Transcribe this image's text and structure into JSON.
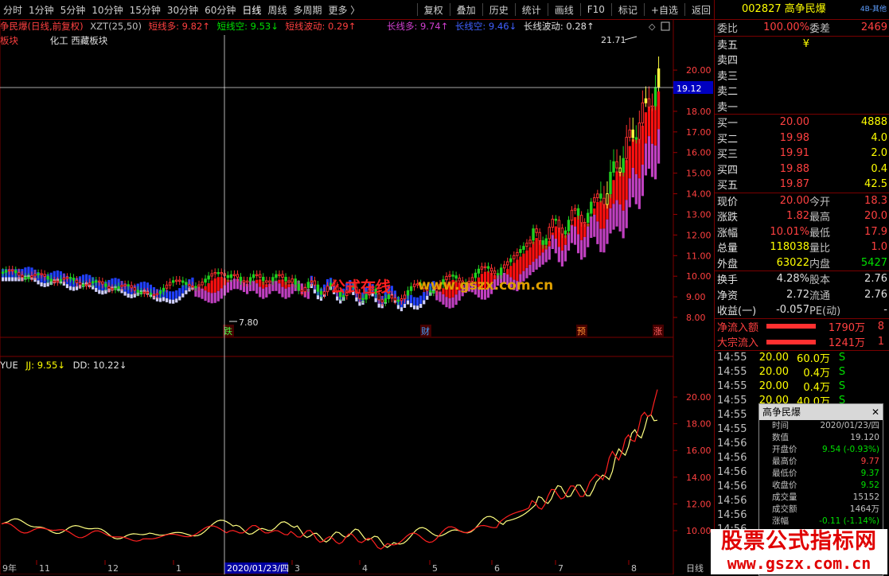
{
  "toolbar": {
    "periods": [
      "分时",
      "1分钟",
      "5分钟",
      "10分钟",
      "15分钟",
      "30分钟",
      "60分钟",
      "日线",
      "周线",
      "多周期",
      "更多 〉"
    ],
    "actions": [
      "复权",
      "叠加",
      "历史",
      "统计",
      "画线",
      "F10",
      "标记",
      "+自选",
      "返回"
    ]
  },
  "indicator_line": {
    "stock": "争民爆(日线,前复权)",
    "formula": "XZT(25,50)",
    "short_long": "短线多: 9.82↑",
    "short_short": "短线空: 9.53↓",
    "short_vol": "短线波动: 0.29↑",
    "long_long": "长线多: 9.74↑",
    "long_short": "长线空: 9.46↓",
    "long_vol": "长线波动: 0.28↑"
  },
  "sector_line": {
    "a": "板块",
    "b": "化工 西藏板块"
  },
  "main_chart": {
    "y_ticks": [
      "20.00",
      "19.00",
      "18.00",
      "17.00",
      "16.00",
      "15.00",
      "14.00",
      "13.00",
      "12.00",
      "11.00",
      "10.00",
      "9.00",
      "8.00"
    ],
    "high_label": "21.71",
    "low_label": "7.80",
    "cursor_price": "19.12",
    "events": [
      "跌",
      "财",
      "预",
      "涨"
    ]
  },
  "sub_chart": {
    "name": "YUE",
    "jj": "JJ: 9.55↓",
    "dd": "DD: 10.22↓",
    "y_ticks": [
      "20.00",
      "18.00",
      "16.00",
      "14.00",
      "12.00",
      "10.00"
    ]
  },
  "x_axis": {
    "labels": [
      "9年",
      "11",
      "12",
      "1",
      "2020/01/23/四",
      "3",
      "4",
      "5",
      "6",
      "7",
      "8"
    ],
    "period": "日线"
  },
  "watermark_center": {
    "a": "公式在线",
    "b": "www.gszx.com.cn"
  },
  "quote": {
    "code_name": "002827 高争民爆",
    "tag": "4B-其他",
    "weibi_label": "委比",
    "weibi": "100.00%",
    "weicha_label": "委差",
    "weicha": "2469",
    "sells": [
      {
        "l": "卖五",
        "p": "¥"
      },
      {
        "l": "卖四",
        "p": ""
      },
      {
        "l": "卖三",
        "p": ""
      },
      {
        "l": "卖二",
        "p": ""
      },
      {
        "l": "卖一",
        "p": ""
      }
    ],
    "buys": [
      {
        "l": "买一",
        "p": "20.00",
        "v": "4888"
      },
      {
        "l": "买二",
        "p": "19.98",
        "v": "4.0"
      },
      {
        "l": "买三",
        "p": "19.91",
        "v": "2.0"
      },
      {
        "l": "买四",
        "p": "19.88",
        "v": "0.4"
      },
      {
        "l": "买五",
        "p": "19.87",
        "v": "42.5"
      }
    ],
    "stats": [
      {
        "l": "现价",
        "v": "20.00",
        "l2": "今开",
        "v2": "18.3"
      },
      {
        "l": "涨跌",
        "v": "1.82",
        "l2": "最高",
        "v2": "20.0"
      },
      {
        "l": "涨幅",
        "v": "10.01%",
        "l2": "最低",
        "v2": "17.9"
      },
      {
        "l": "总量",
        "v": "118038",
        "l2": "量比",
        "v2": "1.0"
      },
      {
        "l": "外盘",
        "v": "63022",
        "l2": "内盘",
        "v2": "5427"
      }
    ],
    "stats2": [
      {
        "l": "换手",
        "v": "4.28%",
        "l2": "股本",
        "v2": "2.76"
      },
      {
        "l": "净资",
        "v": "2.72",
        "l2": "流通",
        "v2": "2.76"
      },
      {
        "l": "收益(一)",
        "v": "-0.057",
        "l2": "PE(动)",
        "v2": "-"
      }
    ],
    "flows": [
      {
        "l": "净流入额",
        "v": "1790万",
        "x": "8"
      },
      {
        "l": "大宗流入",
        "v": "1241万",
        "x": "1"
      }
    ],
    "ticks": [
      {
        "t": "14:55",
        "p": "20.00",
        "v": "60.0万",
        "s": "S"
      },
      {
        "t": "14:55",
        "p": "20.00",
        "v": "0.4万",
        "s": "S"
      },
      {
        "t": "14:55",
        "p": "20.00",
        "v": "0.4万",
        "s": "S"
      },
      {
        "t": "14:55",
        "p": "20.00",
        "v": "40.0万",
        "s": "S"
      },
      {
        "t": "14:55",
        "p": "",
        "v": "",
        "s": ""
      },
      {
        "t": "14:55",
        "p": "",
        "v": "",
        "s": ""
      },
      {
        "t": "14:56",
        "p": "",
        "v": "",
        "s": ""
      },
      {
        "t": "14:56",
        "p": "",
        "v": "",
        "s": ""
      },
      {
        "t": "14:56",
        "p": "",
        "v": "",
        "s": ""
      },
      {
        "t": "14:56",
        "p": "",
        "v": "",
        "s": ""
      },
      {
        "t": "14:56",
        "p": "",
        "v": "",
        "s": ""
      },
      {
        "t": "14:56",
        "p": "",
        "v": "",
        "s": ""
      },
      {
        "t": "14:56",
        "p": "",
        "v": "",
        "s": ""
      }
    ]
  },
  "popup": {
    "title": "高争民爆",
    "rows": [
      {
        "l": "时间",
        "v": "2020/01/23/四",
        "c": "#c0c0c0"
      },
      {
        "l": "数值",
        "v": "19.120",
        "c": "#c0c0c0"
      },
      {
        "l": "开盘价",
        "v": "9.54 (-0.93%)",
        "c": "#00e000"
      },
      {
        "l": "最高价",
        "v": "9.77",
        "c": "#ff4040"
      },
      {
        "l": "最低价",
        "v": "9.37",
        "c": "#00e000"
      },
      {
        "l": "收盘价",
        "v": "9.52",
        "c": "#00e000"
      },
      {
        "l": "成交量",
        "v": "15152",
        "c": "#c0c0c0"
      },
      {
        "l": "成交额",
        "v": "1464万",
        "c": "#c0c0c0"
      },
      {
        "l": "涨幅",
        "v": "-0.11 (-1.14%)",
        "c": "#00e000"
      }
    ]
  },
  "watermark": {
    "a": "股票公式指标网",
    "b": "www.gszx.com.cn"
  }
}
